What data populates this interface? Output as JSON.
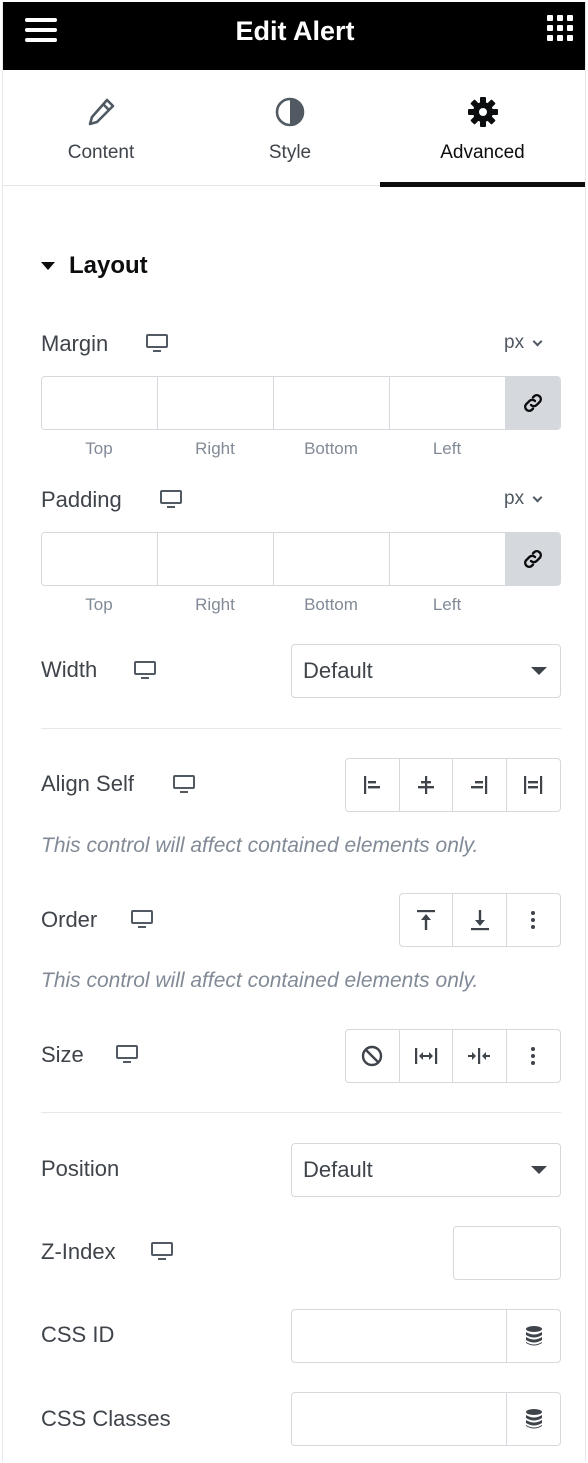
{
  "header": {
    "title": "Edit Alert",
    "menu_icon": "hamburger-icon",
    "apps_icon": "grid-icon"
  },
  "tabs": [
    {
      "label": "Content",
      "icon": "pencil-icon",
      "active": false
    },
    {
      "label": "Style",
      "icon": "half-circle-icon",
      "active": false
    },
    {
      "label": "Advanced",
      "icon": "gear-icon",
      "active": true
    }
  ],
  "section": {
    "title": "Layout"
  },
  "margin": {
    "label": "Margin",
    "unit": "px",
    "values": [
      "",
      "",
      "",
      ""
    ],
    "sides": [
      "Top",
      "Right",
      "Bottom",
      "Left"
    ],
    "linked": true
  },
  "padding": {
    "label": "Padding",
    "unit": "px",
    "values": [
      "",
      "",
      "",
      ""
    ],
    "sides": [
      "Top",
      "Right",
      "Bottom",
      "Left"
    ],
    "linked": true
  },
  "width": {
    "label": "Width",
    "value": "Default"
  },
  "align_self": {
    "label": "Align Self",
    "note": "This control will affect contained elements only.",
    "options": [
      "align-start-icon",
      "align-center-icon",
      "align-end-icon",
      "align-stretch-icon"
    ]
  },
  "order": {
    "label": "Order",
    "note": "This control will affect contained elements only.",
    "options": [
      "order-start-icon",
      "order-end-icon",
      "more-icon"
    ]
  },
  "size": {
    "label": "Size",
    "options": [
      "no-grow-icon",
      "grow-icon",
      "shrink-icon",
      "more-icon"
    ]
  },
  "position": {
    "label": "Position",
    "value": "Default"
  },
  "z_index": {
    "label": "Z-Index",
    "value": ""
  },
  "css_id": {
    "label": "CSS ID",
    "value": ""
  },
  "css_classes": {
    "label": "CSS Classes",
    "value": ""
  },
  "colors": {
    "header_bg": "#000000",
    "text": "#3f444b",
    "muted": "#818a96",
    "border": "#d5d8dc",
    "active_tab": "#0c0d0e"
  }
}
